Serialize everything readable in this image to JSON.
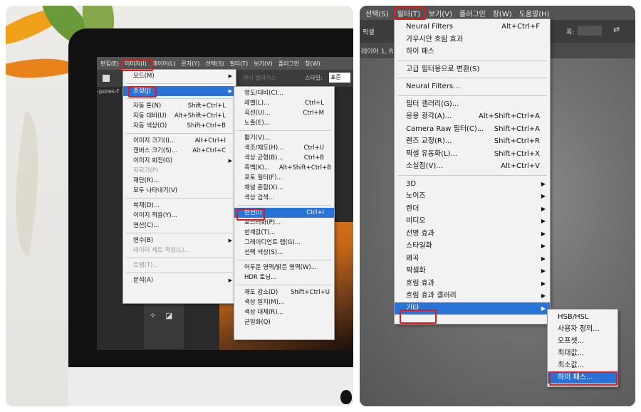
{
  "left": {
    "ps_menubar": [
      "편집(E)",
      "이미지(I)",
      "레이어(L)",
      "문자(Y)",
      "선택(S)",
      "필터(T)",
      "보기(V)",
      "플러그인",
      "창(W)"
    ],
    "options_bar": {
      "style_label": "스타일:",
      "style_value": "표준",
      "faded_label": "엔티 앨리어스"
    },
    "doc_tab": "-pores-f",
    "image_menu": {
      "items": [
        {
          "label": "모드(M)",
          "arrow": "▶"
        },
        {
          "label": "조정(J)",
          "arrow": "▶",
          "highlight": true
        },
        {
          "label": "자동 톤(N)",
          "shortcut": "Shift+Ctrl+L"
        },
        {
          "label": "자동 대비(U)",
          "shortcut": "Alt+Shift+Ctrl+L"
        },
        {
          "label": "자동 색상(O)",
          "shortcut": "Shift+Ctrl+B"
        },
        {
          "label": "이미지 크기(I)...",
          "shortcut": "Alt+Ctrl+I"
        },
        {
          "label": "캔버스 크기(S)...",
          "shortcut": "Alt+Ctrl+C"
        },
        {
          "label": "이미지 회전(G)",
          "arrow": "▶"
        },
        {
          "label": "자르기(P)",
          "disabled": true
        },
        {
          "label": "재단(R)..."
        },
        {
          "label": "모두 나타내기(V)"
        },
        {
          "label": "복제(D)..."
        },
        {
          "label": "이미지 적용(Y)..."
        },
        {
          "label": "연산(C)..."
        },
        {
          "label": "변수(B)",
          "arrow": "▶"
        },
        {
          "label": "데이터 세트 적용(L)...",
          "disabled": true
        },
        {
          "label": "트랩(T)...",
          "disabled": true
        },
        {
          "label": "분석(A)",
          "arrow": "▶"
        }
      ]
    },
    "adjust_menu": {
      "items": [
        {
          "label": "명도/대비(C)..."
        },
        {
          "label": "레벨(L)...",
          "shortcut": "Ctrl+L"
        },
        {
          "label": "곡선(U)...",
          "shortcut": "Ctrl+M"
        },
        {
          "label": "노출(E)..."
        },
        {
          "label": "활기(V)..."
        },
        {
          "label": "색조/채도(H)...",
          "shortcut": "Ctrl+U"
        },
        {
          "label": "색상 균형(B)...",
          "shortcut": "Ctrl+B"
        },
        {
          "label": "흑백(K)...",
          "shortcut": "Alt+Shift+Ctrl+B"
        },
        {
          "label": "포토 필터(F)..."
        },
        {
          "label": "채널 혼합(X)..."
        },
        {
          "label": "색상 검색..."
        },
        {
          "label": "반전(I)",
          "shortcut": "Ctrl+I",
          "highlight": true
        },
        {
          "label": "포스터화(P)..."
        },
        {
          "label": "한계값(T)..."
        },
        {
          "label": "그레이디언트 맵(G)..."
        },
        {
          "label": "선택 색상(S)..."
        },
        {
          "label": "어두운 영역/밝은 영역(W)..."
        },
        {
          "label": "HDR 토닝..."
        },
        {
          "label": "채도 감소(D)",
          "shortcut": "Shift+Ctrl+U"
        },
        {
          "label": "색상 일치(M)..."
        },
        {
          "label": "색상 대체(R)..."
        },
        {
          "label": "균일화(Q)"
        }
      ]
    }
  },
  "right": {
    "menubar": [
      "선택(S)",
      "필터(T)",
      "보기(V)",
      "플러그인",
      "창(W)",
      "도움말(H)"
    ],
    "options_bar": {
      "left_label": "픽셀",
      "width_label": "폭:"
    },
    "doc_tab": "레이어 1, R",
    "filter_menu": {
      "items": [
        {
          "label": "Neural Filters",
          "shortcut": "Alt+Ctrl+F"
        },
        {
          "label": "가우시안 흐림 효과"
        },
        {
          "label": "하이 패스"
        },
        {
          "label": "고급 필터용으로 변환(S)"
        },
        {
          "label": "Neural Filters..."
        },
        {
          "label": "필터 갤러리(G)..."
        },
        {
          "label": "응용 광각(A)...",
          "shortcut": "Alt+Shift+Ctrl+A"
        },
        {
          "label": "Camera Raw 필터(C)...",
          "shortcut": "Shift+Ctrl+A"
        },
        {
          "label": "렌즈 교정(R)...",
          "shortcut": "Shift+Ctrl+R"
        },
        {
          "label": "픽셀 유동화(L)...",
          "shortcut": "Shift+Ctrl+X"
        },
        {
          "label": "소실점(V)...",
          "shortcut": "Alt+Ctrl+V"
        },
        {
          "label": "3D",
          "arrow": "▶"
        },
        {
          "label": "노이즈",
          "arrow": "▶"
        },
        {
          "label": "렌더",
          "arrow": "▶"
        },
        {
          "label": "비디오",
          "arrow": "▶"
        },
        {
          "label": "선명 효과",
          "arrow": "▶"
        },
        {
          "label": "스타일화",
          "arrow": "▶"
        },
        {
          "label": "왜곡",
          "arrow": "▶"
        },
        {
          "label": "픽셀화",
          "arrow": "▶"
        },
        {
          "label": "흐림 효과",
          "arrow": "▶"
        },
        {
          "label": "흐림 효과 갤러리",
          "arrow": "▶"
        },
        {
          "label": "기타",
          "arrow": "▶",
          "highlight": true
        }
      ]
    },
    "other_menu": {
      "items": [
        {
          "label": "HSB/HSL"
        },
        {
          "label": "사용자 정의..."
        },
        {
          "label": "오프셋..."
        },
        {
          "label": "최대값..."
        },
        {
          "label": "최소값..."
        },
        {
          "label": "하이 패스...",
          "highlight": true
        }
      ]
    }
  }
}
